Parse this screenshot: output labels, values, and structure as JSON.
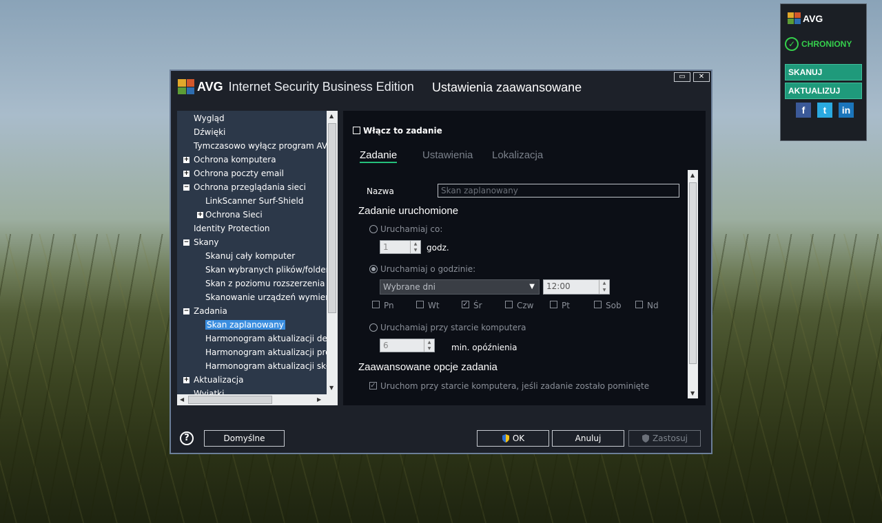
{
  "gadget": {
    "brand": "AVG",
    "status": "CHRONIONY",
    "scan_label": "SKANUJ",
    "update_label": "AKTUALIZUJ",
    "social": [
      {
        "icon": "facebook-icon",
        "glyph": "f",
        "color": "#3b5998"
      },
      {
        "icon": "twitter-icon",
        "glyph": "t",
        "color": "#2aa9e0"
      },
      {
        "icon": "linkedin-icon",
        "glyph": "in",
        "color": "#1b75bb"
      }
    ]
  },
  "window": {
    "brand": "AVG",
    "product": "Internet Security Business Edition",
    "section_title": "Ustawienia zaawansowane",
    "maximize_glyph": "▭",
    "close_glyph": "✕"
  },
  "tree": {
    "items": [
      {
        "label": "Wygląd",
        "expander": ""
      },
      {
        "label": "Dźwięki",
        "expander": ""
      },
      {
        "label": "Tymczasowo wyłącz program AVG",
        "expander": ""
      },
      {
        "label": "Ochrona komputera",
        "expander": "+"
      },
      {
        "label": "Ochrona poczty email",
        "expander": "+"
      },
      {
        "label": "Ochrona przeglądania sieci",
        "expander": "−"
      },
      {
        "label": "LinkScanner Surf-Shield",
        "expander": ""
      },
      {
        "label": "Ochrona Sieci",
        "expander": "+"
      },
      {
        "label": "Identity Protection",
        "expander": ""
      },
      {
        "label": "Skany",
        "expander": "−"
      },
      {
        "label": "Skanuj cały komputer",
        "expander": ""
      },
      {
        "label": "Skan wybranych plików/folderów",
        "expander": ""
      },
      {
        "label": "Skan z poziomu rozszerzenia powłoki",
        "expander": ""
      },
      {
        "label": "Skanowanie urządzeń wymiennych",
        "expander": ""
      },
      {
        "label": "Zadania",
        "expander": "−"
      },
      {
        "label": "Skan zaplanowany",
        "expander": "",
        "selected": true
      },
      {
        "label": "Harmonogram aktualizacji definicji",
        "expander": ""
      },
      {
        "label": "Harmonogram aktualizacji programu",
        "expander": ""
      },
      {
        "label": "Harmonogram aktualizacji składników",
        "expander": ""
      },
      {
        "label": "Aktualizacja",
        "expander": "+"
      },
      {
        "label": "Wyjątki",
        "expander": ""
      }
    ]
  },
  "panel": {
    "enable_task_label": "Włącz to zadanie",
    "tabs": [
      "Zadanie",
      "Ustawienia",
      "Lokalizacja"
    ],
    "name_label": "Nazwa",
    "name_value": "Skan zaplanowany",
    "run_section": "Zadanie uruchomione",
    "run_every_label": "Uruchamiaj co:",
    "run_every_value": "1",
    "hours_unit": "godz.",
    "run_at_label": "Uruchamiaj o godzinie:",
    "days_select": "Wybrane dni",
    "time_value": "12:00",
    "days": [
      {
        "label": "Pn",
        "checked": false
      },
      {
        "label": "Wt",
        "checked": false
      },
      {
        "label": "Śr",
        "checked": true
      },
      {
        "label": "Czw",
        "checked": false
      },
      {
        "label": "Pt",
        "checked": false
      },
      {
        "label": "Sob",
        "checked": false
      },
      {
        "label": "Nd",
        "checked": false
      }
    ],
    "run_at_startup_label": "Uruchamiaj przy starcie komputera",
    "delay_value": "6",
    "delay_unit": "min. opóźnienia",
    "advanced_section": "Zaawansowane opcje zadania",
    "run_missed_label": "Uruchom przy starcie komputera, jeśli zadanie zostało pominięte"
  },
  "footer": {
    "help_glyph": "?",
    "defaults_label": "Domyślne",
    "ok_label": "OK",
    "cancel_label": "Anuluj",
    "apply_label": "Zastosuj"
  }
}
